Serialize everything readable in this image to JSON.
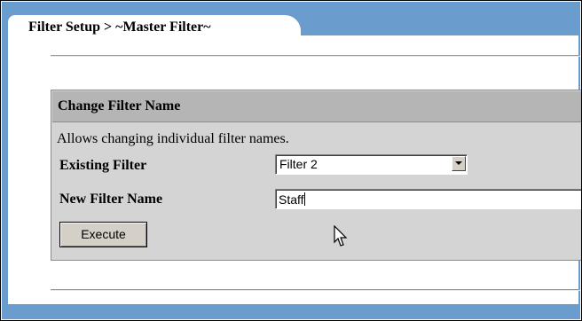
{
  "tab": {
    "title": "Filter Setup > ~Master Filter~"
  },
  "section": {
    "title": "Change Filter Name",
    "description": "Allows changing individual filter names."
  },
  "form": {
    "existing_filter_label": "Existing Filter",
    "existing_filter_value": "Filter 2",
    "new_filter_name_label": "New Filter Name",
    "new_filter_name_value": "Staff",
    "execute_label": "Execute"
  },
  "icons": {
    "dropdown": "chevron-down-icon",
    "pointer": "mouse-pointer-icon"
  },
  "colors": {
    "background_blue": "#6a9ccd",
    "group_background": "#d4d4d4",
    "group_header": "#b5b5b5"
  }
}
